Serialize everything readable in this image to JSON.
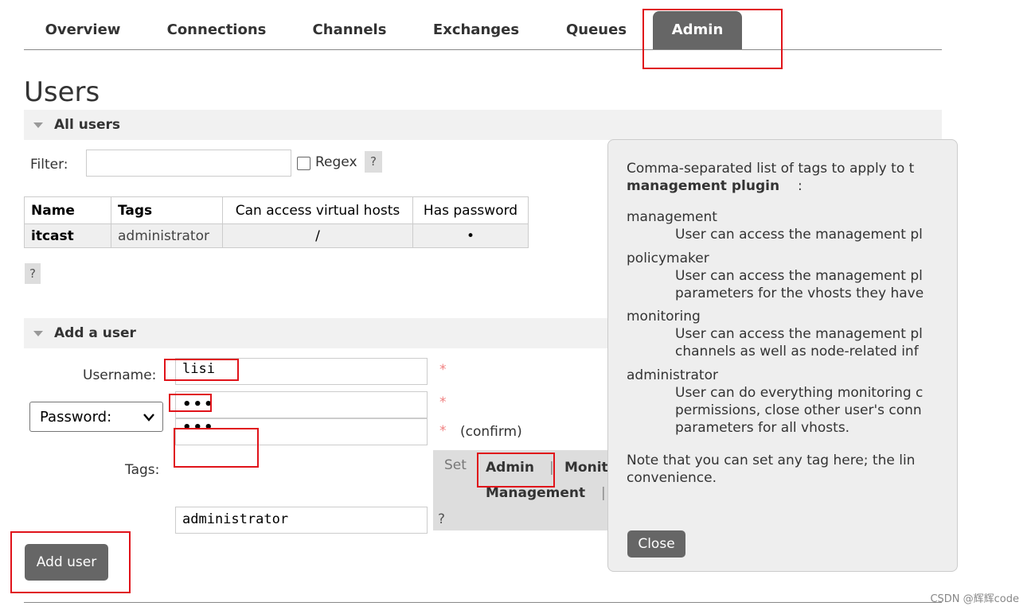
{
  "nav": {
    "tabs": [
      {
        "label": "Overview"
      },
      {
        "label": "Connections"
      },
      {
        "label": "Channels"
      },
      {
        "label": "Exchanges"
      },
      {
        "label": "Queues"
      },
      {
        "label": "Admin",
        "active": true
      }
    ]
  },
  "page_title": "Users",
  "all_users": {
    "section_label": "All users",
    "filter_label": "Filter:",
    "filter_value": "",
    "regex_label": "Regex",
    "help": "?",
    "table": {
      "headers": [
        "Name",
        "Tags",
        "Can access virtual hosts",
        "Has password"
      ],
      "rows": [
        {
          "name": "itcast",
          "tags": "administrator",
          "vhosts": "/",
          "has_password": "•"
        }
      ]
    },
    "table_help": "?"
  },
  "add_user": {
    "section_label": "Add a user",
    "username_label": "Username:",
    "username_value": "lisi",
    "password_select": "Password:",
    "password_mask": "•••",
    "confirm_mask": "•••",
    "required_mark": "*",
    "confirm_label": "(confirm)",
    "tags_label": "Tags:",
    "tags_value": "administrator",
    "tag_set_label": "Set",
    "tag_options": [
      "Admin",
      "Monit",
      "Management"
    ],
    "tag_separator": "|",
    "tags_help": "?",
    "submit_label": "Add user"
  },
  "tooltip": {
    "intro_line1": "Comma-separated list of tags to apply to t",
    "intro_line2": "management plugin",
    "intro_line2_suffix": ":",
    "items": [
      {
        "term": "management",
        "desc": [
          "User can access the management pl"
        ]
      },
      {
        "term": "policymaker",
        "desc": [
          "User can access the management pl",
          "parameters for the vhosts they have"
        ]
      },
      {
        "term": "monitoring",
        "desc": [
          "User can access the management pl",
          "channels as well as node-related inf"
        ]
      },
      {
        "term": "administrator",
        "desc": [
          "User can do everything monitoring c",
          "permissions, close other user's conn",
          "parameters for all vhosts."
        ]
      }
    ],
    "note_line1": "Note that you can set any tag here; the lin",
    "note_line2": "convenience.",
    "close_label": "Close"
  },
  "watermark": "CSDN @辉辉code",
  "colors": {
    "accent": "#666666",
    "highlight": "#e0131a",
    "required": "#f08080"
  }
}
